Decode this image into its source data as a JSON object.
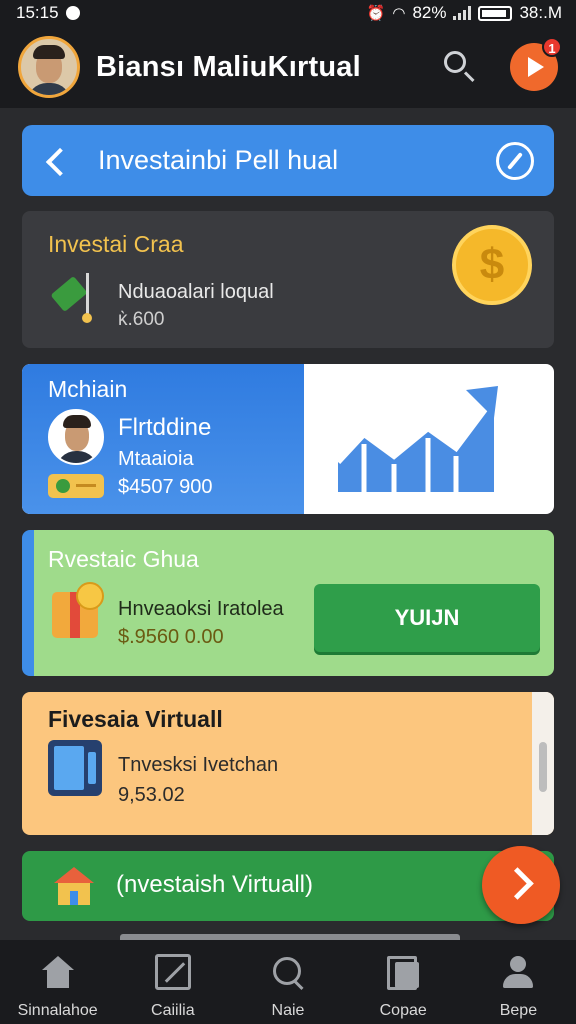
{
  "status_bar": {
    "time": "15:15",
    "battery_text": "82%",
    "right_time": "38:.M"
  },
  "app_bar": {
    "title": "Biansı MaliuKırtual",
    "notification_count": "1"
  },
  "header": {
    "title": "Investainbi Pell hual"
  },
  "cards": [
    {
      "title": "Investai Craa",
      "line1": "Nduaoalari loqual",
      "line2": "ĸ̀.600"
    },
    {
      "title": "Mchiain",
      "line1": "Flrtddine",
      "line2": "Mtaaioia",
      "line3": "$4507 900"
    },
    {
      "title": "Rvestaic Ghua",
      "line1": "Hnveaoksi Iratolea",
      "line2": "$.9560 0.00",
      "button": "YUIJN"
    },
    {
      "title": "Fivesaia Virtuall",
      "line1": "Tnvesksi Ivetchan",
      "line2": "9,53.02"
    },
    {
      "title": "(nvestaish Virtuall)"
    }
  ],
  "bottom_nav": [
    {
      "label": "Sinnalahoe",
      "icon": "home-icon"
    },
    {
      "label": "Caiilia",
      "icon": "chart-icon"
    },
    {
      "label": "Naie",
      "icon": "search-icon"
    },
    {
      "label": "Copae",
      "icon": "copy-icon"
    },
    {
      "label": "Bepe",
      "icon": "user-icon"
    }
  ],
  "colors": {
    "accent_blue": "#3e8de8",
    "accent_orange": "#f0692c",
    "green": "#2e9a47",
    "coin": "#f5b82a"
  }
}
